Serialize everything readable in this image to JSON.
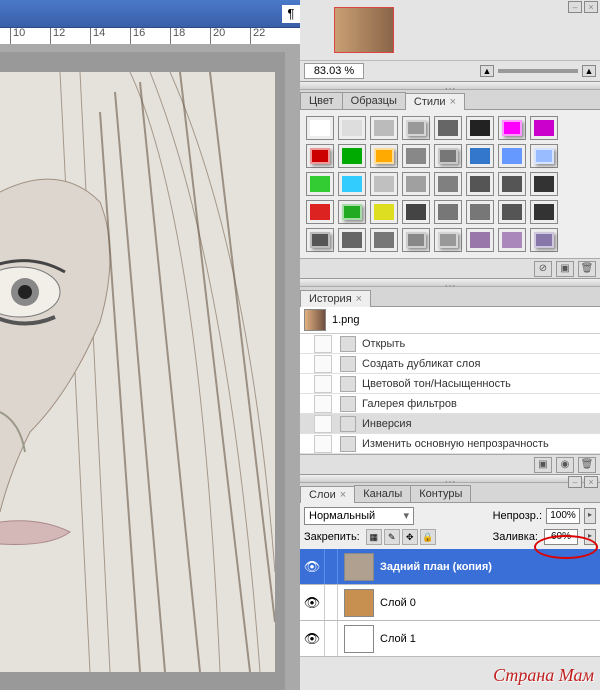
{
  "ruler": [
    "10",
    "12",
    "14",
    "16",
    "18",
    "20",
    "22"
  ],
  "nav": {
    "zoom": "83.03 %"
  },
  "color_tabs": {
    "t1": "Цвет",
    "t2": "Образцы",
    "t3": "Стили"
  },
  "swatches": [
    [
      "#ffffff",
      "#dddddd",
      "#bbbbbb",
      "#999999",
      "#666666",
      "#222222",
      "#ff00ff",
      "#cc00cc"
    ],
    [
      "#cc0000",
      "#00aa00",
      "#ffaa00",
      "#888888",
      "#777777",
      "#3377cc",
      "#6699ff",
      "#99bbff"
    ],
    [
      "#33cc33",
      "#33ccff",
      "#c0c0c0",
      "#a0a0a0",
      "#808080",
      "#555555",
      "#555555",
      "#333333"
    ],
    [
      "#dd2222",
      "#22aa22",
      "#dddd22",
      "#444444",
      "#777777",
      "#777777",
      "#555555",
      "#333333"
    ],
    [
      "#555555",
      "#666666",
      "#777777",
      "#888888",
      "#999999",
      "#9977aa",
      "#aa88bb",
      "#8877aa"
    ]
  ],
  "history": {
    "title": "История",
    "file": "1.png",
    "items": [
      "Открыть",
      "Создать дубликат слоя",
      "Цветовой тон/Насыщенность",
      "Галерея фильтров",
      "Инверсия",
      "Изменить основную непрозрачность"
    ],
    "selected": 4
  },
  "layers": {
    "tabs": {
      "t1": "Слои",
      "t2": "Каналы",
      "t3": "Контуры"
    },
    "blend": "Нормальный",
    "opacity_label": "Непрозр.:",
    "opacity_val": "100%",
    "lock_label": "Закрепить:",
    "fill_label": "Заливка:",
    "fill_val": "60%",
    "items": [
      {
        "name": "Задний план (копия)",
        "selected": true,
        "thumb": "#b0a090"
      },
      {
        "name": "Слой 0",
        "selected": false,
        "thumb": "#c89050"
      },
      {
        "name": "Слой 1",
        "selected": false,
        "thumb": "#ffffff"
      }
    ]
  },
  "watermark": "Страна Мам",
  "icons": {
    "pilcrow": "¶"
  }
}
